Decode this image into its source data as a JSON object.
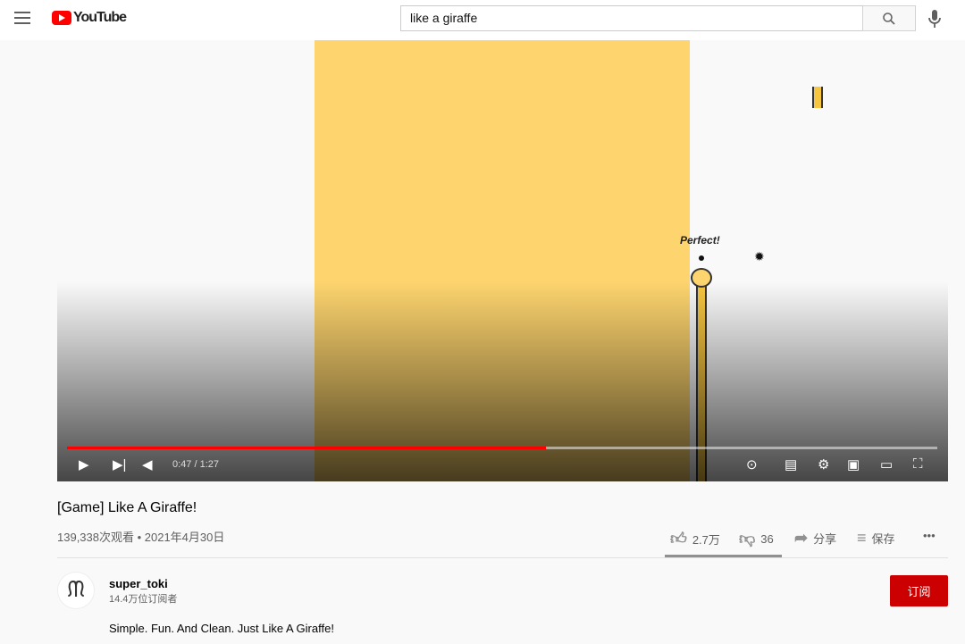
{
  "header": {
    "logo": "YouTube",
    "search_value": "like a giraffe",
    "search_icon": "search-icon",
    "mic_icon": "mic-icon"
  },
  "player": {
    "game_text": "Perfect!",
    "time": "0:47 / 1:27",
    "progress_fraction": 0.55,
    "accent": "#ff0000",
    "game_bg": "#fdd46e"
  },
  "video": {
    "title": "[Game] Like A Giraffe!",
    "meta": "139,338次观看 • 2021年4月30日"
  },
  "actions": {
    "likes": "2.7万",
    "dislikes": "36",
    "share": "分享",
    "save": "保存",
    "more": "•••"
  },
  "channel": {
    "avatar": "ᙏ",
    "name": "super_toki",
    "subscribers": "14.4万位订阅者",
    "subscribe": "订阅",
    "subscribe_color": "#cc0000"
  },
  "description": "Simple. Fun. And Clean. Just Like A Giraffe!"
}
